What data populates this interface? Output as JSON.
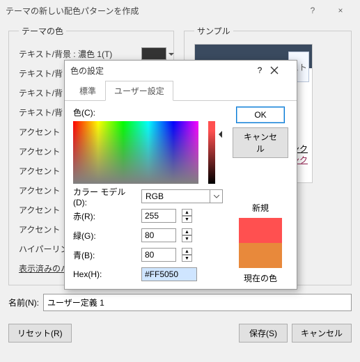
{
  "window": {
    "title": "テーマの新しい配色パターンを作成",
    "help": "?",
    "close": "×"
  },
  "panel": {
    "theme_colors_legend": "テーマの色",
    "sample_legend": "サンプル",
    "rows": [
      "テキスト/背景 : 濃色 1(T)",
      "テキスト/背",
      "テキスト/背",
      "テキスト/背",
      "アクセント",
      "アクセント",
      "アクセント",
      "アクセント",
      "アクセント",
      "アクセント",
      "ハイパーリン",
      "表示済みのハイパーリンク(F)"
    ],
    "sample_tab_label": "スト",
    "link1": "ーリンク",
    "link2": "ーリンク",
    "name_label": "名前(N):",
    "name_value": "ユーザー定義 1",
    "reset": "リセット(R)",
    "save": "保存(S)",
    "cancel": "キャンセル"
  },
  "dialog": {
    "title": "色の設定",
    "help": "?",
    "close": "×",
    "tab_standard": "標準",
    "tab_user": "ユーザー設定",
    "ok": "OK",
    "cancel": "キャンセル",
    "color_label": "色(C):",
    "model_label": "カラー モデル(D):",
    "model_value": "RGB",
    "r_label": "赤(R):",
    "r_value": "255",
    "g_label": "緑(G):",
    "g_value": "80",
    "b_label": "青(B):",
    "b_value": "80",
    "hex_label": "Hex(H):",
    "hex_value": "#FF5050",
    "new_label": "新規",
    "current_label": "現在の色"
  }
}
